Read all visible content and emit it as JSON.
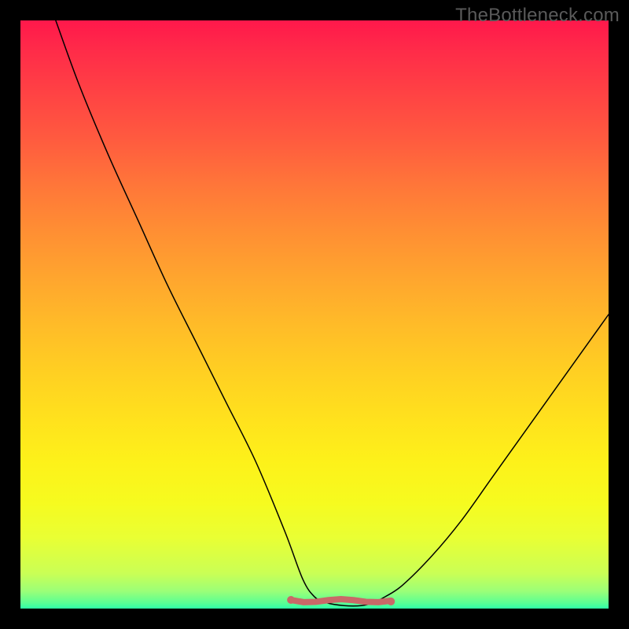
{
  "watermark": "TheBottleneck.com",
  "colors": {
    "background": "#000000",
    "curve": "#000000",
    "marker": "#c96868",
    "gradient_top": "#ff184b",
    "gradient_bottom": "#2fffa8"
  },
  "chart_data": {
    "type": "line",
    "title": "",
    "xlabel": "",
    "ylabel": "",
    "xlim": [
      0,
      100
    ],
    "ylim": [
      0,
      100
    ],
    "description": "V-shaped bottleneck curve over red-to-green vertical gradient; minimum plateau near x≈50–60 at y≈0, left branch rises steeply to y≈100 at x≈6, right branch rises to y≈50 at x≈100.",
    "series": [
      {
        "name": "bottleneck_curve",
        "x": [
          6,
          10,
          15,
          20,
          25,
          30,
          35,
          40,
          45,
          48,
          50,
          52,
          55,
          58,
          60,
          62,
          65,
          70,
          75,
          80,
          85,
          90,
          95,
          100
        ],
        "y": [
          100,
          89,
          77,
          66,
          55,
          45,
          35,
          25,
          13,
          5,
          2,
          1,
          0.5,
          0.5,
          1,
          2,
          4,
          9,
          15,
          22,
          29,
          36,
          43,
          50
        ]
      }
    ],
    "marker_region": {
      "x_start": 46,
      "x_end": 63,
      "y": 1.2
    }
  }
}
